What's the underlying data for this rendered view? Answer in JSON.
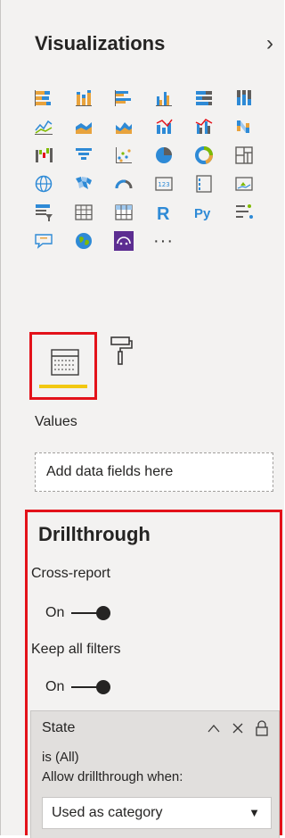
{
  "pane": {
    "title": "Visualizations"
  },
  "visuals": {
    "rows": [
      [
        "stacked-bar-chart-icon",
        "stacked-column-chart-icon",
        "clustered-bar-chart-icon",
        "clustered-column-chart-icon",
        "100-stacked-bar-chart-icon",
        "100-stacked-column-chart-icon"
      ],
      [
        "line-chart-icon",
        "area-chart-icon",
        "stacked-area-chart-icon",
        "line-and-stacked-column-chart-icon",
        "line-and-clustered-column-chart-icon",
        "ribbon-chart-icon"
      ],
      [
        "waterfall-chart-icon",
        "funnel-chart-icon",
        "scatter-chart-icon",
        "pie-chart-icon",
        "donut-chart-icon",
        "treemap-icon"
      ],
      [
        "map-icon",
        "filled-map-icon",
        "gauge-icon",
        "card-icon",
        "multi-row-card-icon",
        "kpi-icon"
      ],
      [
        "slicer-icon",
        "table-icon",
        "matrix-icon",
        "r-visual-icon",
        "python-visual-icon",
        "key-influencers-icon"
      ],
      [
        "qa-icon",
        "globe-map-icon",
        "custom-visual-icon",
        "more-visuals-icon"
      ]
    ],
    "r_label": "R",
    "py_label": "Py",
    "more_label": "···"
  },
  "tabs": {
    "fields": "fields-tab",
    "format": "format-tab"
  },
  "values": {
    "label": "Values",
    "placeholder": "Add data fields here"
  },
  "drillthrough": {
    "title": "Drillthrough",
    "cross_report": {
      "label": "Cross-report",
      "state": "On"
    },
    "keep_filters": {
      "label": "Keep all filters",
      "state": "On"
    },
    "filter_card": {
      "field": "State",
      "condition": "is (All)",
      "allow_label": "Allow drillthrough when:",
      "allow_value": "Used as category",
      "arrow": "▼"
    }
  },
  "colors": {
    "accent_red": "#e3121a",
    "accent_yellow": "#f2c811",
    "chart_blue": "#2e8ad6",
    "chart_green": "#7fba00"
  }
}
